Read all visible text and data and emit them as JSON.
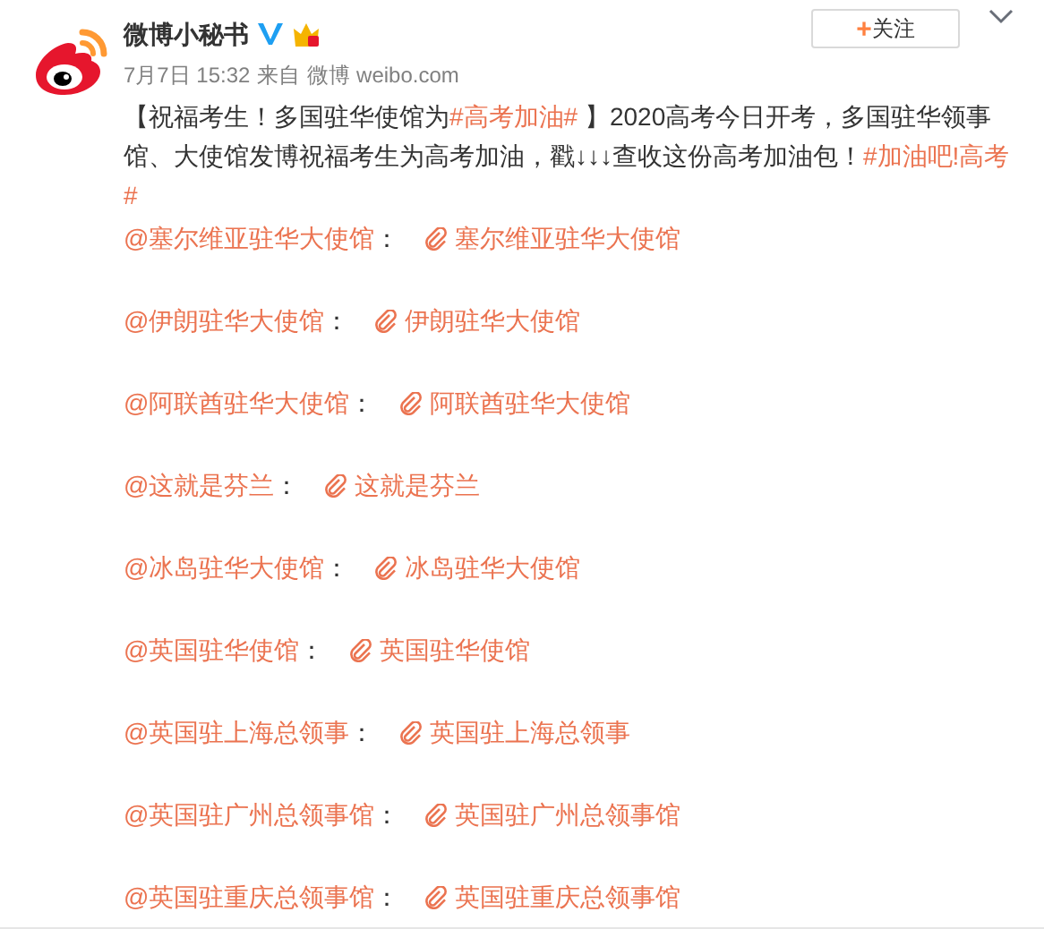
{
  "author": {
    "name": "微博小秘书",
    "verified": true
  },
  "meta": {
    "time": "7月7日 15:32",
    "source_prefix": "来自",
    "source": "微博 weibo.com"
  },
  "follow_button": {
    "label": "关注",
    "icon": "+"
  },
  "post": [
    {
      "kind": "text",
      "text": "【祝福考生！多国驻华使馆为"
    },
    {
      "kind": "topic",
      "text": "#高考加油#"
    },
    {
      "kind": "text",
      "text": " 】2020高考今日开考，多国驻华领事馆、大使馆发博祝福考生为高考加油，戳↓↓↓查收这份高考加油包！"
    },
    {
      "kind": "topic",
      "text": "#加油吧!高考#"
    }
  ],
  "entries": [
    {
      "mention": "@塞尔维亚驻华大使馆",
      "separator": "：",
      "link": "塞尔维亚驻华大使馆"
    },
    {
      "mention": "@伊朗驻华大使馆",
      "separator": "：",
      "link": "伊朗驻华大使馆"
    },
    {
      "mention": "@阿联酋驻华大使馆",
      "separator": "：",
      "link": "阿联酋驻华大使馆"
    },
    {
      "mention": "@这就是芬兰",
      "separator": "：",
      "link": "这就是芬兰"
    },
    {
      "mention": "@冰岛驻华大使馆",
      "separator": "：",
      "link": "冰岛驻华大使馆"
    },
    {
      "mention": "@英国驻华使馆",
      "separator": "：",
      "link": "英国驻华使馆"
    },
    {
      "mention": "@英国驻上海总领事",
      "separator": "：",
      "link": "英国驻上海总领事"
    },
    {
      "mention": "@英国驻广州总领事馆",
      "separator": "：",
      "link": "英国驻广州总领事馆"
    },
    {
      "mention": "@英国驻重庆总领事馆",
      "separator": "：",
      "link": "英国驻重庆总领事馆"
    }
  ]
}
